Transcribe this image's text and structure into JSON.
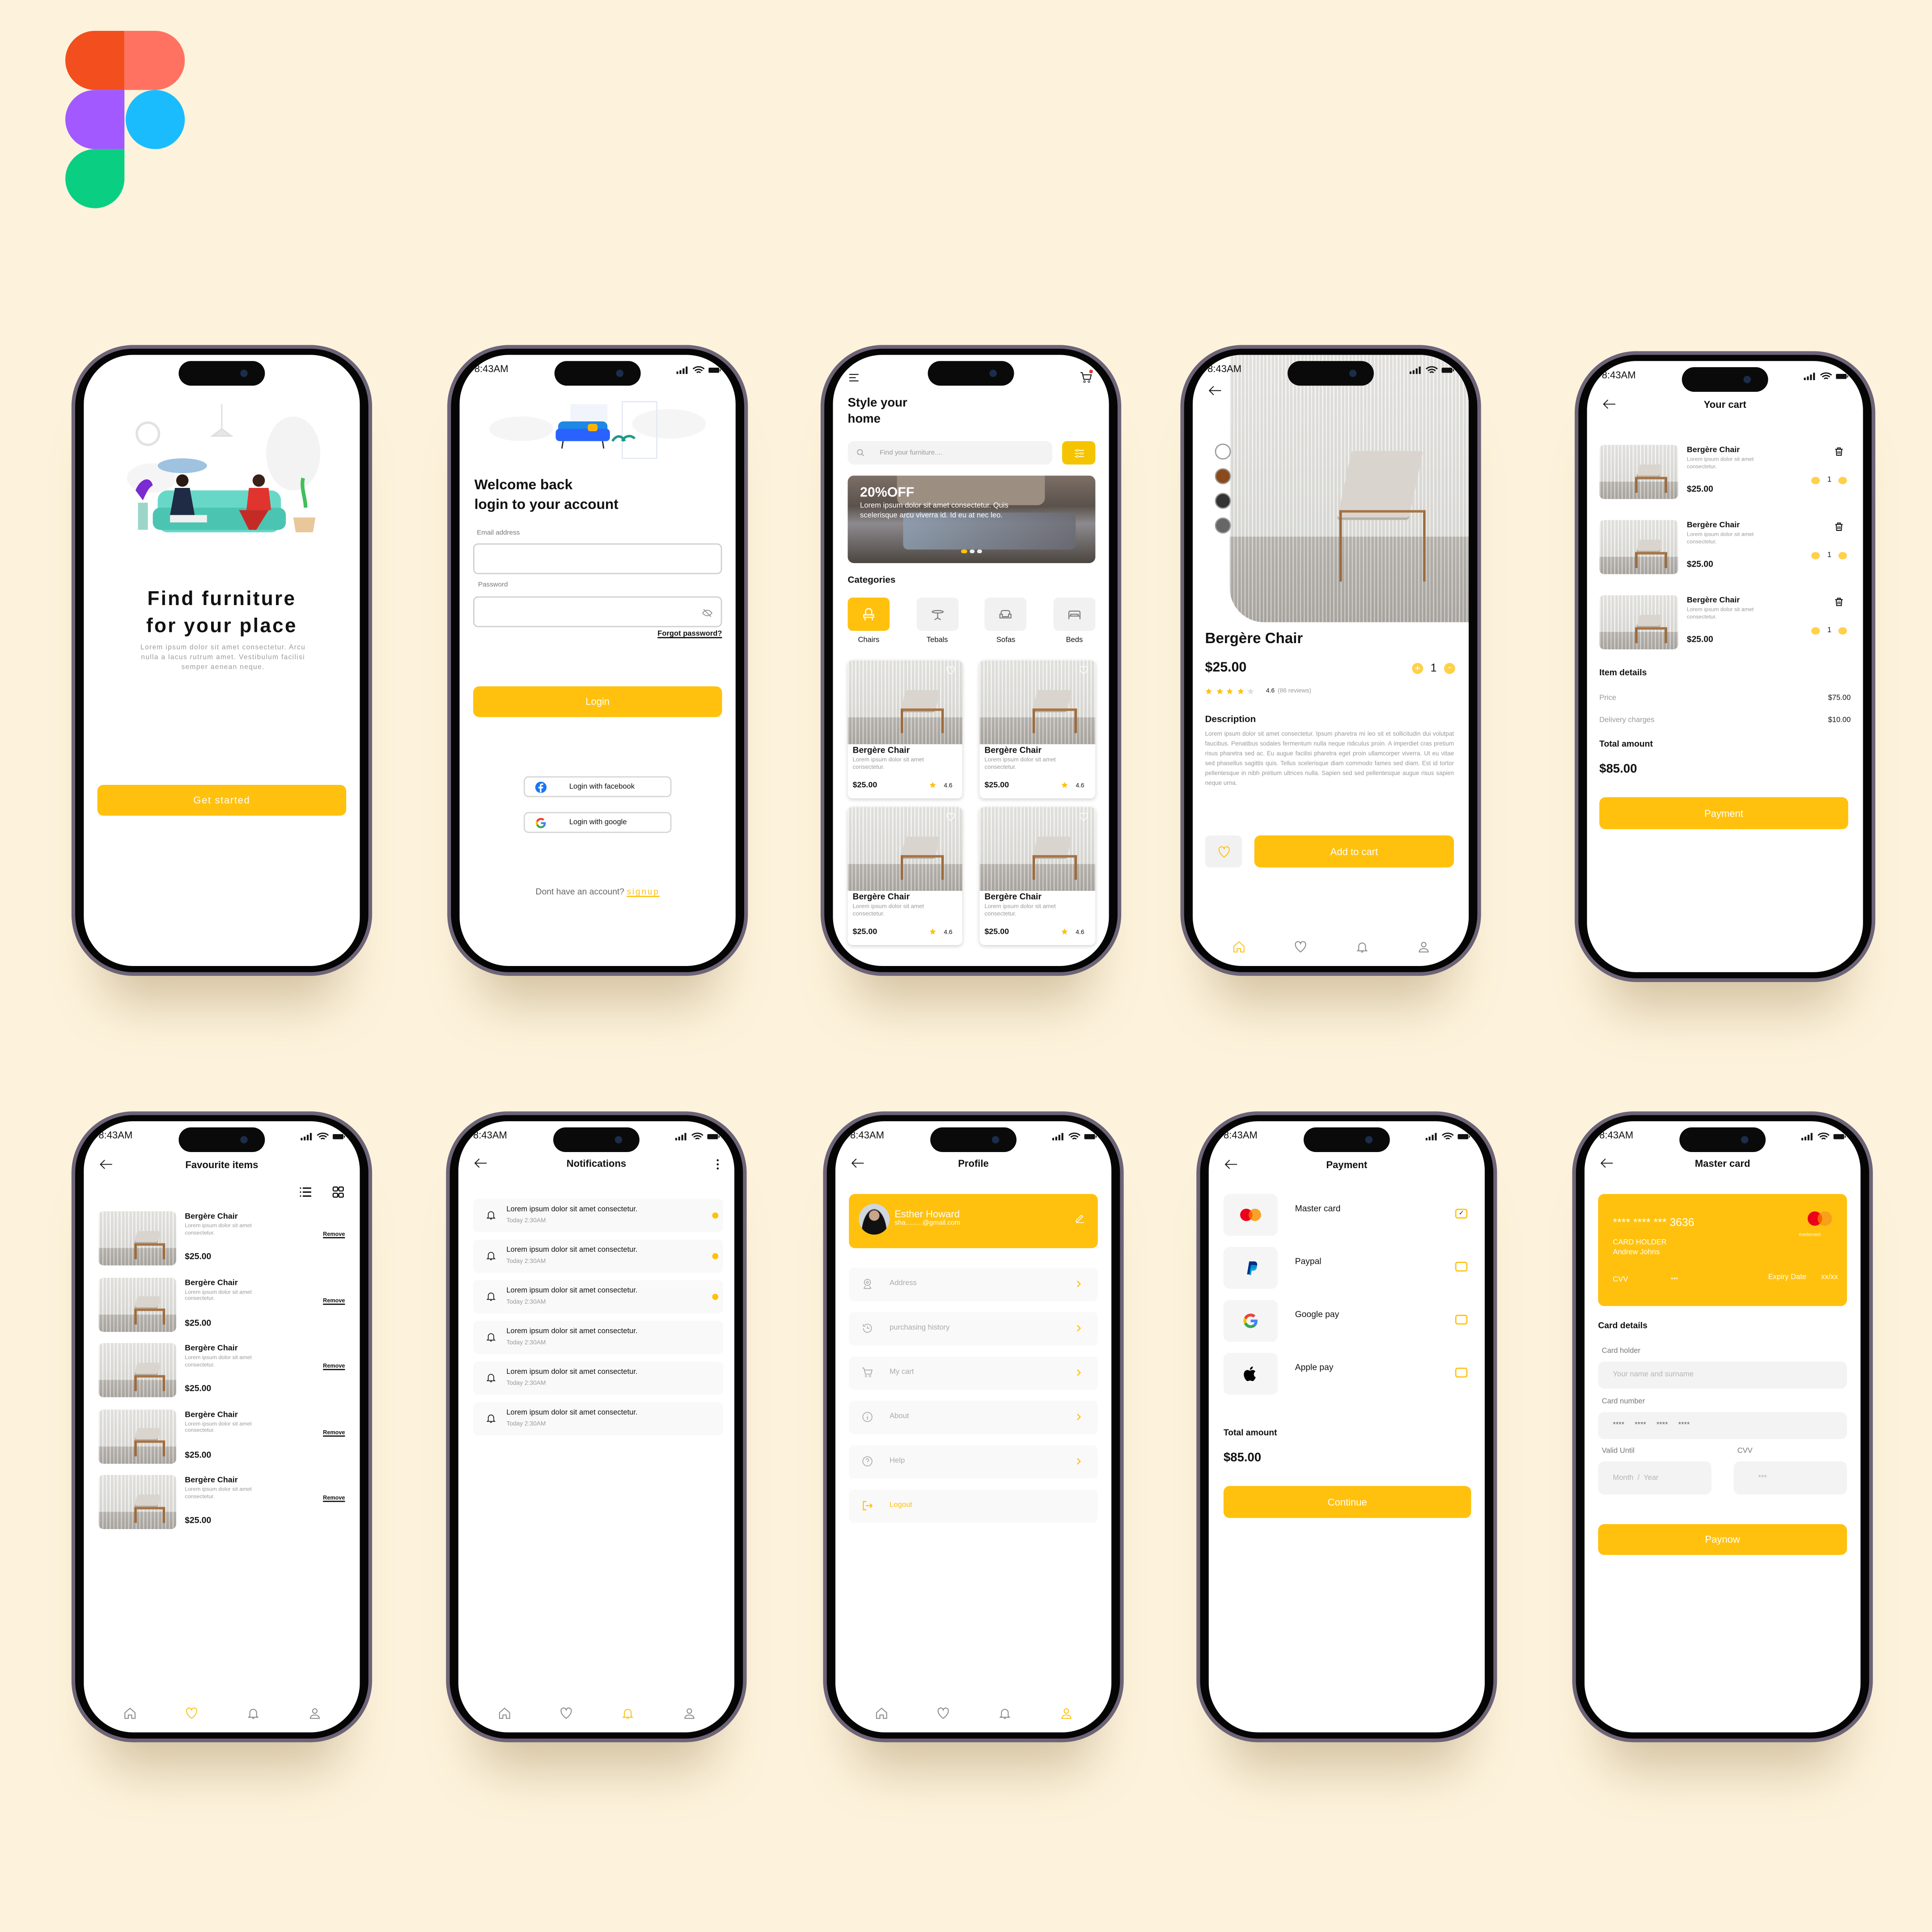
{
  "colors": {
    "accent": "#FFC10E",
    "background": "#FDF3DC",
    "frame": "#6D6478"
  },
  "status_time": "8:43AM",
  "onboarding": {
    "title_line1": "Find furniture",
    "title_line2": "for your place",
    "body": "Lorem ipsum dolor sit amet consectetur. Arcu nulla a lacus rutrum amet. Vestibulum facilisi semper aenean neque.",
    "cta": "Get started"
  },
  "login": {
    "title_line1": "Welcome back",
    "title_line2": "login to your account",
    "email_label": "Email address",
    "password_label": "Password",
    "forgot": "Forgot password?",
    "login_button": "Login",
    "facebook_button": "Login with facebook",
    "google_button": "Login with google",
    "no_account": "Dont have an account?",
    "signup": "signup"
  },
  "home": {
    "title_line1": "Style your",
    "title_line2": "home",
    "search_placeholder": "Find your furniture....",
    "banner_headline": "20%OFF",
    "banner_body": "Lorem ipsum dolor sit amet consectetur. Quis scelerisque arcu viverra id. Id eu at nec leo.",
    "categories_title": "Categories",
    "categories": [
      {
        "label": "Chairs",
        "icon": "chair-icon",
        "active": true
      },
      {
        "label": "Tebals",
        "icon": "table-icon",
        "active": false
      },
      {
        "label": "Sofas",
        "icon": "sofa-icon",
        "active": false
      },
      {
        "label": "Beds",
        "icon": "bed-icon",
        "active": false
      }
    ],
    "products": [
      {
        "name": "Bergère Chair",
        "desc": "Lorem ipsum dolor sit amet consectetur.",
        "price": "$25.00",
        "rating": "4.6"
      },
      {
        "name": "Bergère Chair",
        "desc": "Lorem ipsum dolor sit amet consectetur.",
        "price": "$25.00",
        "rating": "4.6"
      },
      {
        "name": "Bergère Chair",
        "desc": "Lorem ipsum dolor sit amet consectetur.",
        "price": "$25.00",
        "rating": "4.6"
      },
      {
        "name": "Bergère Chair",
        "desc": "Lorem ipsum dolor sit amet consectetur.",
        "price": "$25.00",
        "rating": "4.6"
      }
    ]
  },
  "detail": {
    "name": "Bergère Chair",
    "price": "$25.00",
    "quantity": "1",
    "rating": "4.6",
    "stars": 4,
    "reviews": "(86 reviews)",
    "color_options": [
      "#FFFFFF",
      "#8B4A1C",
      "#333333",
      "#666666"
    ],
    "description_title": "Description",
    "description": "Lorem ipsum dolor sit amet consectetur. Ipsum pharetra mi leo sit et sollicitudin dui volutpat faucibus. Penatibus sodales fermentum nulla neque ridiculus proin. A imperdiet cras pretium risus pharetra sed ac. Eu augue facilisi pharetra eget proin ullamcorper viverra. Ut eu vitae sed phasellus sagittis quis. Tellus scelerisque diam commodo fames sed diam. Est id tortor pellentesque in nibh pretium ultrices nulla. Sapien sed sed pellentesque augue risus sapien neque urna.",
    "add_to_cart": "Add to cart"
  },
  "cart": {
    "title": "Your cart",
    "items": [
      {
        "name": "Bergère Chair",
        "desc": "Lorem ipsum dolor sit amet consectetur.",
        "price": "$25.00",
        "qty": "1"
      },
      {
        "name": "Bergère Chair",
        "desc": "Lorem ipsum dolor sit amet consectetur.",
        "price": "$25.00",
        "qty": "1"
      },
      {
        "name": "Bergère Chair",
        "desc": "Lorem ipsum dolor sit amet consectetur.",
        "price": "$25.00",
        "qty": "1"
      }
    ],
    "item_details": "Item details",
    "price_label": "Price",
    "price_value": "$75.00",
    "delivery_label": "Delivery charges",
    "delivery_value": "$10.00",
    "total_label": "Total amount",
    "total_value": "$85.00",
    "payment_button": "Payment"
  },
  "favourites": {
    "title": "Favourite items",
    "remove": "Remove",
    "items": [
      {
        "name": "Bergère Chair",
        "desc": "Lorem ipsum dolor sit amet consectetur.",
        "price": "$25.00"
      },
      {
        "name": "Bergère Chair",
        "desc": "Lorem ipsum dolor sit amet consectetur.",
        "price": "$25.00"
      },
      {
        "name": "Bergère Chair",
        "desc": "Lorem ipsum dolor sit amet consectetur.",
        "price": "$25.00"
      },
      {
        "name": "Bergère Chair",
        "desc": "Lorem ipsum dolor sit amet consectetur.",
        "price": "$25.00"
      },
      {
        "name": "Bergère Chair",
        "desc": "Lorem ipsum dolor sit amet consectetur.",
        "price": "$25.00"
      }
    ]
  },
  "notifications": {
    "title": "Notifications",
    "items": [
      {
        "text": "Lorem ipsum dolor sit amet consectetur.",
        "time": "Today 2:30AM",
        "unread": true
      },
      {
        "text": "Lorem ipsum dolor sit amet consectetur.",
        "time": "Today 2:30AM",
        "unread": true
      },
      {
        "text": "Lorem ipsum dolor sit amet consectetur.",
        "time": "Today 2:30AM",
        "unread": true
      },
      {
        "text": "Lorem ipsum dolor sit amet consectetur.",
        "time": "Today 2:30AM",
        "unread": false
      },
      {
        "text": "Lorem ipsum dolor sit amet consectetur.",
        "time": "Today 2:30AM",
        "unread": false
      },
      {
        "text": "Lorem ipsum dolor sit amet consectetur.",
        "time": "Today 2:30AM",
        "unread": false
      }
    ]
  },
  "profile": {
    "title": "Profile",
    "name": "Esther Howard",
    "email": "sha.........@gmail.com",
    "items": [
      {
        "label": "Address",
        "icon": "location-icon"
      },
      {
        "label": "purchasing history",
        "icon": "history-icon"
      },
      {
        "label": "My cart",
        "icon": "cart-icon"
      },
      {
        "label": "About",
        "icon": "info-icon"
      },
      {
        "label": "Help",
        "icon": "help-icon"
      }
    ],
    "logout": "Logout"
  },
  "payment": {
    "title": "Payment",
    "methods": [
      {
        "label": "Master card",
        "icon": "mastercard-icon",
        "checked": true
      },
      {
        "label": "Paypal",
        "icon": "paypal-icon",
        "checked": false
      },
      {
        "label": "Google pay",
        "icon": "google-icon",
        "checked": false
      },
      {
        "label": "Apple pay",
        "icon": "apple-icon",
        "checked": false
      }
    ],
    "total_label": "Total amount",
    "total_value": "$85.00",
    "continue": "Continue"
  },
  "card": {
    "title": "Master card",
    "number": "**** **** *** 3636",
    "brand": "mastercard",
    "holder_label": "CARD HOLDER",
    "holder_name": "Andrew Johns",
    "cvv_label": "CVV",
    "cvv_value": "***",
    "expiry_label": "Expiry Date",
    "expiry_value": "xx/xx",
    "details_title": "Card details",
    "holder_field_label": "Card holder",
    "holder_placeholder": "Your name and surname",
    "number_field_label": "Card number",
    "number_placeholder": "****     ****     ****     ****",
    "valid_label": "Valid Until",
    "valid_placeholder": "Month  /  Year",
    "cvv_field_label": "CVV",
    "cvv_placeholder": "***",
    "paynow": "Paynow"
  }
}
